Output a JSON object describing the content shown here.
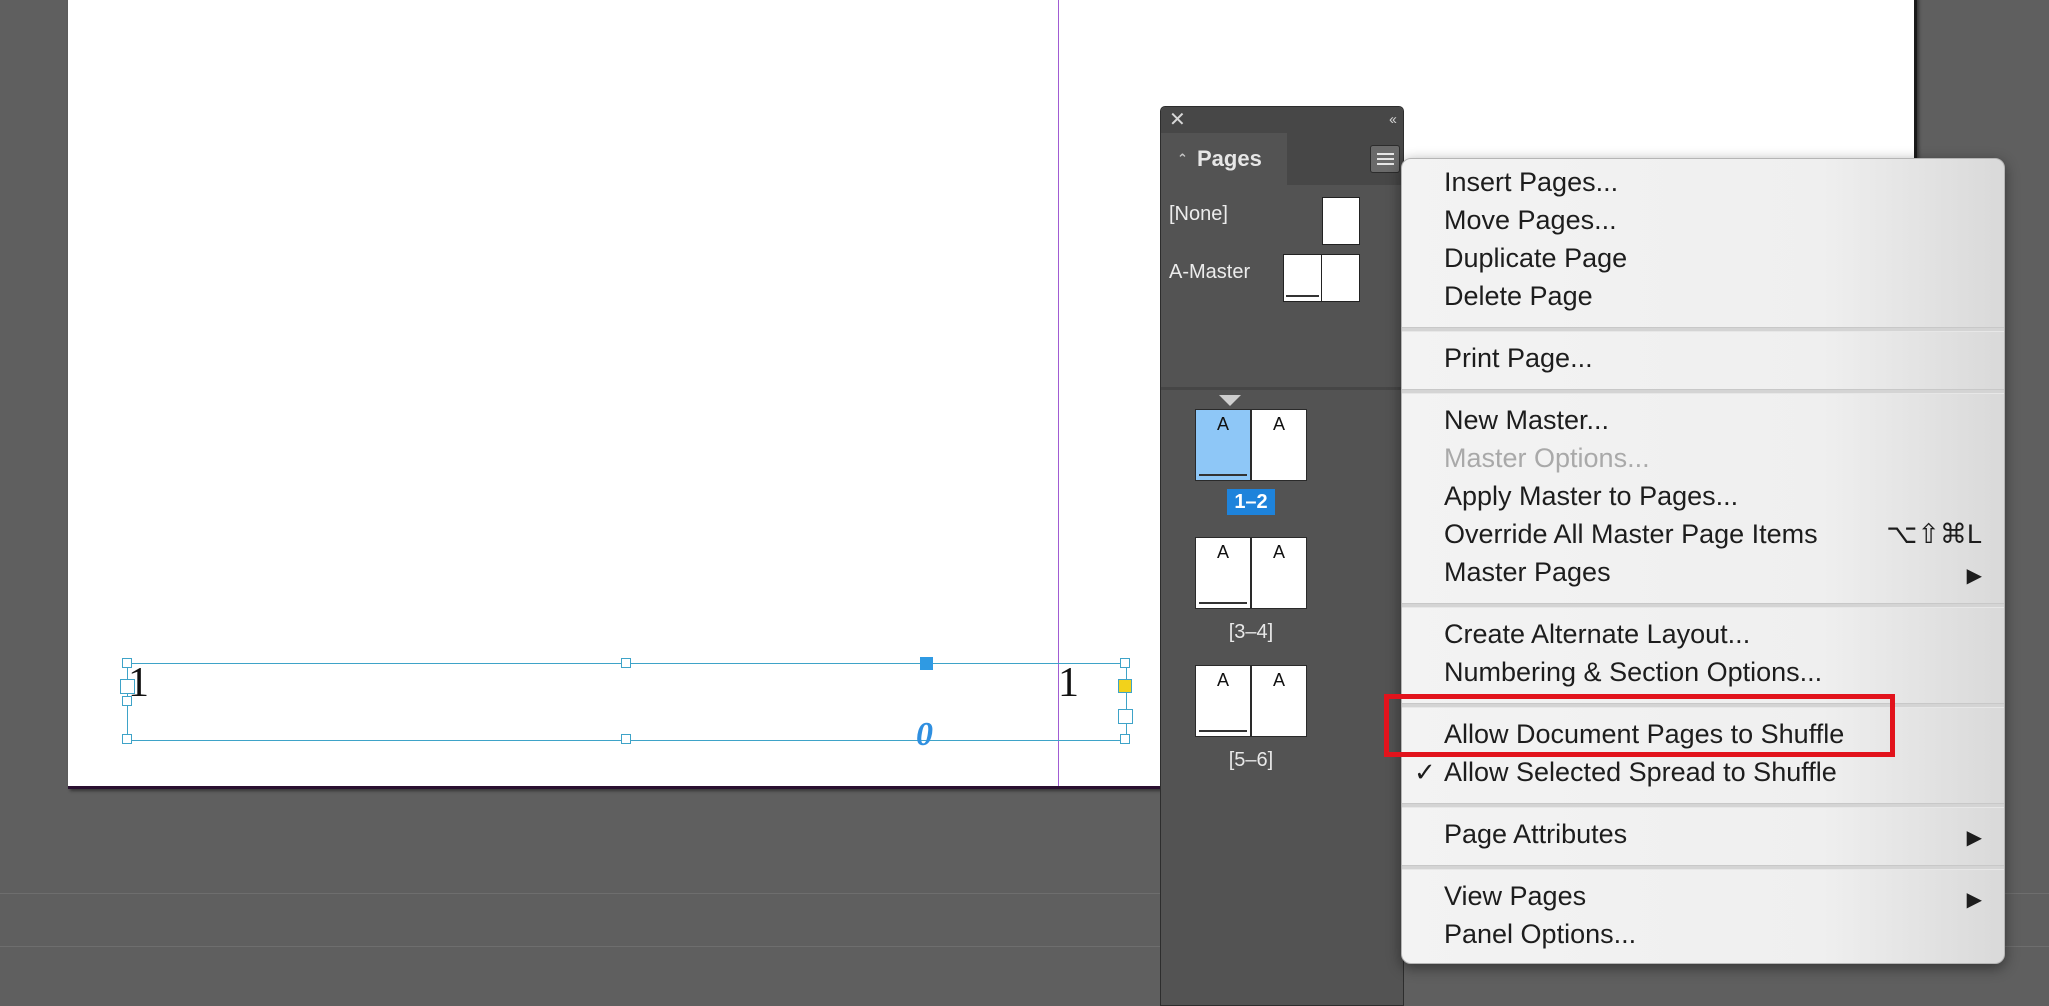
{
  "document": {
    "page_number_left": "1",
    "page_number_right": "1",
    "flow_glyph": "0"
  },
  "panel": {
    "close_glyph": "✕",
    "collapse_glyph": "‹‹",
    "tab_label": "Pages",
    "masters": [
      {
        "label": "[None]"
      },
      {
        "label": "A-Master"
      }
    ],
    "spreads": [
      {
        "label": "1–2",
        "left_master": "A",
        "right_master": "A",
        "selected": true
      },
      {
        "label": "[3–4]",
        "left_master": "A",
        "right_master": "A",
        "selected": false
      },
      {
        "label": "[5–6]",
        "left_master": "A",
        "right_master": "A",
        "selected": false
      }
    ]
  },
  "menu": {
    "items": {
      "insert_pages": "Insert Pages...",
      "move_pages": "Move Pages...",
      "duplicate_page": "Duplicate Page",
      "delete_page": "Delete Page",
      "print_page": "Print Page...",
      "new_master": "New Master...",
      "master_options": "Master Options...",
      "apply_master": "Apply Master to Pages...",
      "override_all": "Override All Master Page Items",
      "override_all_shortcut": "⌥⇧⌘L",
      "master_pages": "Master Pages",
      "create_alt_layout": "Create Alternate Layout...",
      "numbering_section": "Numbering & Section Options...",
      "allow_doc_shuffle": "Allow Document Pages to Shuffle",
      "allow_spread_shuffle": "Allow Selected Spread to Shuffle",
      "page_attributes": "Page Attributes",
      "view_pages": "View Pages",
      "panel_options": "Panel Options..."
    },
    "check_glyph": "✓",
    "submenu_glyph": "▶"
  },
  "colors": {
    "accent_selection": "#1e83db",
    "highlight_box": "#e2131c",
    "frame_stroke": "#3ea3c8",
    "spine": "#a15cd3"
  }
}
